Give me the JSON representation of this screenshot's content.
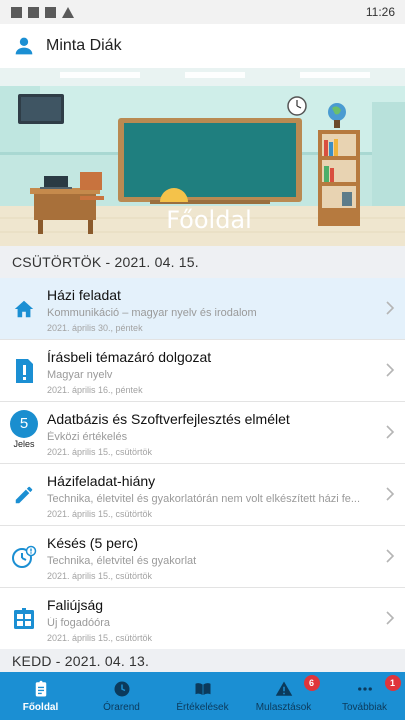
{
  "status_bar": {
    "time": "11:26"
  },
  "app_bar": {
    "user_name": "Minta Diák"
  },
  "hero": {
    "title": "Főoldal"
  },
  "sections": [
    {
      "label": "CSÜTÖRTÖK - 2021. 04. 15."
    },
    {
      "label": "KEDD - 2021. 04. 13."
    }
  ],
  "items": [
    {
      "icon": "home-icon",
      "title": "Házi feladat",
      "subtitle": "Kommunikáció – magyar nyelv és irodalom",
      "date": "2021. április 30., péntek",
      "selected": true
    },
    {
      "icon": "exclamation-icon",
      "title": "Írásbeli témazáró dolgozat",
      "subtitle": "Magyar nyelv",
      "date": "2021. április 16., péntek"
    },
    {
      "icon": "grade-badge",
      "grade": "5",
      "grade_label": "Jeles",
      "title": "Adatbázis és Szoftverfejlesztés elmélet",
      "subtitle": "Évközi értékelés",
      "date": "2021. április 15., csütörtök"
    },
    {
      "icon": "pencil-icon",
      "title": "Házifeladat-hiány",
      "subtitle": "Technika, életvitel és gyakorlatórán nem volt elkészített házi fe...",
      "date": "2021. április 15., csütörtök"
    },
    {
      "icon": "late-clock-icon",
      "title": "Késés (5 perc)",
      "subtitle": "Technika, életvitel és gyakorlat",
      "date": "2021. április 15., csütörtök"
    },
    {
      "icon": "noticeboard-icon",
      "title": "Faliújság",
      "subtitle": "Új fogadóóra",
      "date": "2021. április 15., csütörtök"
    }
  ],
  "bottom_nav": [
    {
      "label": "Főoldal",
      "icon": "clipboard-icon",
      "active": true
    },
    {
      "label": "Órarend",
      "icon": "clock-icon"
    },
    {
      "label": "Értékelések",
      "icon": "book-icon"
    },
    {
      "label": "Mulasztások",
      "icon": "warning-icon",
      "badge": "6"
    },
    {
      "label": "Továbbiak",
      "icon": "more-icon",
      "badge": "1"
    }
  ],
  "colors": {
    "primary": "#1b8fd3",
    "badge": "#e0353b",
    "selected_row": "#e4f1fb",
    "section_bg": "#eef0f3"
  }
}
